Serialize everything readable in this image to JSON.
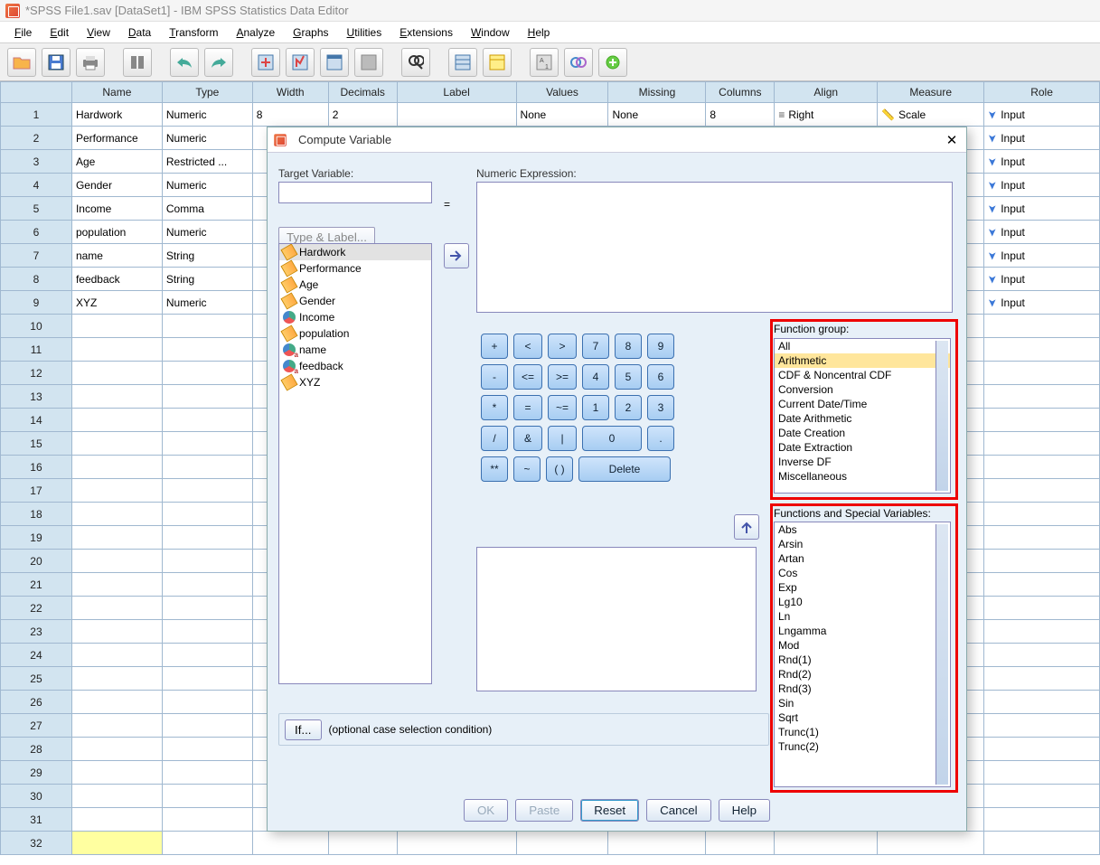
{
  "window": {
    "title": "*SPSS File1.sav [DataSet1] - IBM SPSS Statistics Data Editor"
  },
  "menu": [
    "File",
    "Edit",
    "View",
    "Data",
    "Transform",
    "Analyze",
    "Graphs",
    "Utilities",
    "Extensions",
    "Window",
    "Help"
  ],
  "columns": [
    "Name",
    "Type",
    "Width",
    "Decimals",
    "Label",
    "Values",
    "Missing",
    "Columns",
    "Align",
    "Measure",
    "Role"
  ],
  "rows": [
    {
      "n": "1",
      "name": "Hardwork",
      "type": "Numeric",
      "width": "8",
      "dec": "2",
      "label": "",
      "values": "None",
      "missing": "None",
      "cols": "8",
      "align": "Right",
      "measure": "Scale",
      "role": "Input"
    },
    {
      "n": "2",
      "name": "Performance",
      "type": "Numeric",
      "role": "Input"
    },
    {
      "n": "3",
      "name": "Age",
      "type": "Restricted ...",
      "role": "Input"
    },
    {
      "n": "4",
      "name": "Gender",
      "type": "Numeric",
      "role": "Input"
    },
    {
      "n": "5",
      "name": "Income",
      "type": "Comma",
      "role": "Input"
    },
    {
      "n": "6",
      "name": "population",
      "type": "Numeric",
      "role": "Input"
    },
    {
      "n": "7",
      "name": "name",
      "type": "String",
      "role": "Input"
    },
    {
      "n": "8",
      "name": "feedback",
      "type": "String",
      "role": "Input"
    },
    {
      "n": "9",
      "name": "XYZ",
      "type": "Numeric",
      "role": "Input"
    }
  ],
  "dialog": {
    "title": "Compute Variable",
    "target_label": "Target Variable:",
    "type_label_btn": "Type & Label...",
    "equals": "=",
    "expr_label": "Numeric Expression:",
    "vars": [
      {
        "name": "Hardwork",
        "icon": "ruler",
        "sel": true
      },
      {
        "name": "Performance",
        "icon": "ruler"
      },
      {
        "name": "Age",
        "icon": "ruler"
      },
      {
        "name": "Gender",
        "icon": "ruler"
      },
      {
        "name": "Income",
        "icon": "nom"
      },
      {
        "name": "population",
        "icon": "ruler"
      },
      {
        "name": "name",
        "icon": "str"
      },
      {
        "name": "feedback",
        "icon": "str"
      },
      {
        "name": "XYZ",
        "icon": "ruler"
      }
    ],
    "calc": [
      [
        "+",
        "<",
        ">",
        "7",
        "8",
        "9"
      ],
      [
        "-",
        "<=",
        ">=",
        "4",
        "5",
        "6"
      ],
      [
        "*",
        "=",
        "~=",
        "1",
        "2",
        "3"
      ],
      [
        "/",
        "&",
        "|",
        "0",
        "."
      ],
      [
        "**",
        "~",
        "( )",
        "Delete"
      ]
    ],
    "fg_label": "Function group:",
    "fg": [
      "All",
      "Arithmetic",
      "CDF & Noncentral CDF",
      "Conversion",
      "Current Date/Time",
      "Date Arithmetic",
      "Date Creation",
      "Date Extraction",
      "Inverse DF",
      "Miscellaneous"
    ],
    "fg_sel": "Arithmetic",
    "fv_label": "Functions and Special Variables:",
    "fv": [
      "Abs",
      "Arsin",
      "Artan",
      "Cos",
      "Exp",
      "Lg10",
      "Ln",
      "Lngamma",
      "Mod",
      "Rnd(1)",
      "Rnd(2)",
      "Rnd(3)",
      "Sin",
      "Sqrt",
      "Trunc(1)",
      "Trunc(2)"
    ],
    "if_btn": "If...",
    "if_text": "(optional case selection condition)",
    "buttons": {
      "ok": "OK",
      "paste": "Paste",
      "reset": "Reset",
      "cancel": "Cancel",
      "help": "Help"
    }
  }
}
